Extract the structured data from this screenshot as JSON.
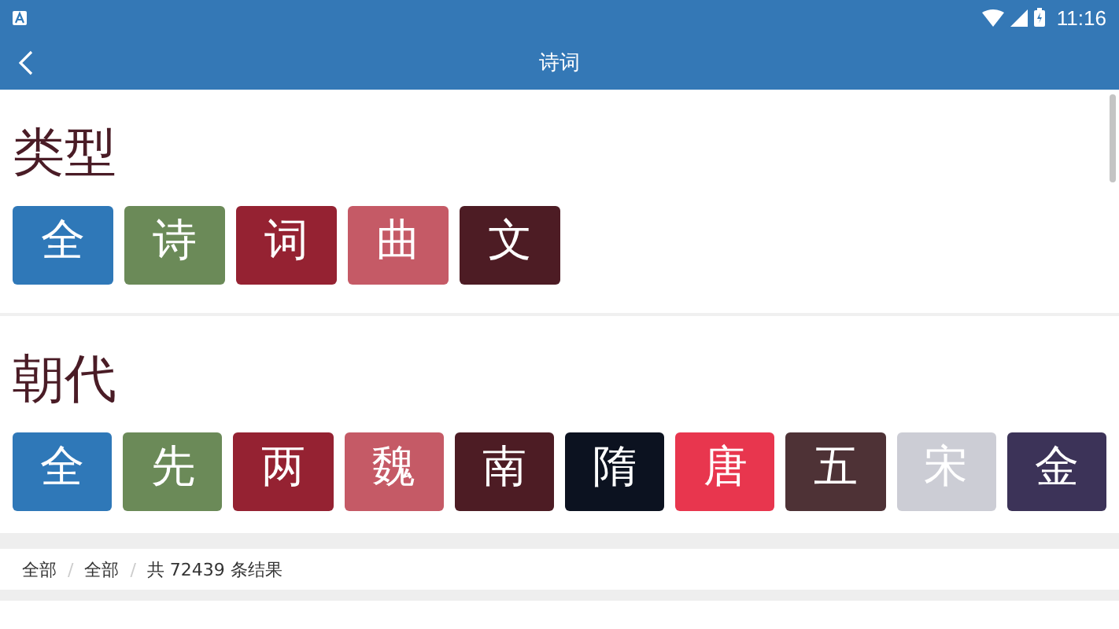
{
  "status_bar": {
    "time": "11:16"
  },
  "header": {
    "title": "诗词"
  },
  "sections": [
    {
      "title": "类型",
      "tiles": [
        {
          "label": "全",
          "color": "#2f78b8"
        },
        {
          "label": "诗",
          "color": "#6b8a58"
        },
        {
          "label": "词",
          "color": "#952232"
        },
        {
          "label": "曲",
          "color": "#c55a66"
        },
        {
          "label": "文",
          "color": "#4d1c24"
        }
      ]
    },
    {
      "title": "朝代",
      "tiles": [
        {
          "label": "全",
          "color": "#2f78b8"
        },
        {
          "label": "先",
          "color": "#6b8a58"
        },
        {
          "label": "两",
          "color": "#952232"
        },
        {
          "label": "魏",
          "color": "#c55a66"
        },
        {
          "label": "南",
          "color": "#4d1c24"
        },
        {
          "label": "隋",
          "color": "#0c1220"
        },
        {
          "label": "唐",
          "color": "#e8364e"
        },
        {
          "label": "五",
          "color": "#4e3236"
        },
        {
          "label": "宋",
          "color": "#cccdd5"
        },
        {
          "label": "金",
          "color": "#3c3358"
        }
      ]
    }
  ],
  "breadcrumb": {
    "items": [
      "全部",
      "全部"
    ],
    "separator": "/",
    "result": "共 72439 条结果"
  }
}
